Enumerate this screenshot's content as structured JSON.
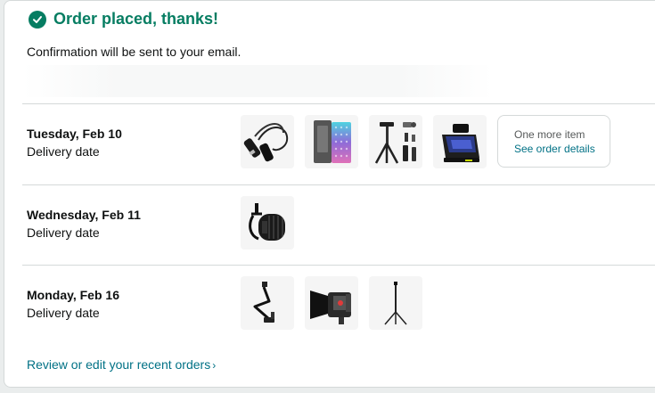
{
  "confirmation": {
    "title": "Order placed, thanks!",
    "subtitle": "Confirmation will be sent to your email."
  },
  "deliveries": [
    {
      "date": "Tuesday, Feb 10",
      "label": "Delivery date",
      "items": [
        "xlr-cable",
        "rgb-led-light-panel",
        "camera-tripod-kit",
        "teleprompter"
      ],
      "more": {
        "line1": "One more item",
        "link": "See order details"
      }
    },
    {
      "date": "Wednesday, Feb 11",
      "label": "Delivery date",
      "items": [
        "podcast-microphone"
      ]
    },
    {
      "date": "Monday, Feb 16",
      "label": "Delivery date",
      "items": [
        "mic-boom-arm",
        "video-light",
        "light-stand"
      ]
    }
  ],
  "footer": {
    "review_link": "Review or edit your recent orders",
    "chevron": "›"
  },
  "colors": {
    "success": "#067d62",
    "link": "#007185",
    "divider": "#d5d9d9"
  }
}
